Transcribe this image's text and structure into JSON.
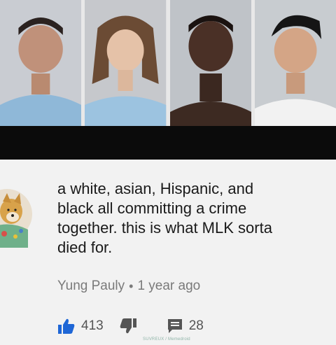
{
  "comment": {
    "text": "a white, asian, Hispanic, and\nblack all committing a crime\ntogether. this is what MLK sorta\ndied for.",
    "author": "Yung Pauly",
    "separator": "•",
    "time": "1 year ago",
    "likes": "413",
    "replies": "28"
  },
  "icons": {
    "like": "thumbs-up-icon",
    "dislike": "thumbs-down-icon",
    "reply": "comment-icon"
  },
  "colors": {
    "like_blue": "#1e66d6",
    "icon_gray": "#555555",
    "meta_gray": "#7a7a7a"
  },
  "watermark": "SUVREUX / Memedroid"
}
